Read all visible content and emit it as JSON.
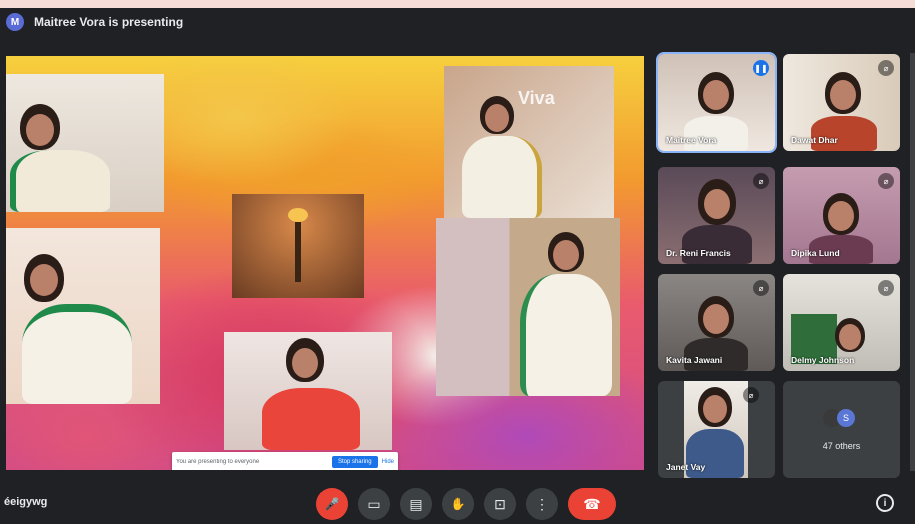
{
  "topbar": {
    "presenter_initial": "M",
    "presenting_text": "Maitree Vora is presenting"
  },
  "presentation": {
    "logo_text": "Viva",
    "banner": {
      "message": "You are presenting to everyone",
      "stop_label": "Stop sharing",
      "hide_label": "Hide"
    }
  },
  "participants": [
    {
      "name": "Maitree Vora",
      "speaking": true
    },
    {
      "name": "Dawat Dhar",
      "speaking": false
    },
    {
      "name": "Dr. Reni Francis",
      "speaking": false
    },
    {
      "name": "Dipika Lund",
      "speaking": false
    },
    {
      "name": "Kavita Jawani",
      "speaking": false
    },
    {
      "name": "Delmy Johnson",
      "speaking": false
    },
    {
      "name": "Janet Vay",
      "speaking": false
    }
  ],
  "others": {
    "avatar_letter": "S",
    "label": "47 others"
  },
  "bottombar": {
    "meeting_code": "éeigywg",
    "controls": {
      "mic": "🎤",
      "camera": "▭",
      "captions": "▤",
      "hand": "✋",
      "present": "⊡",
      "more": "⋮",
      "end": "☎"
    },
    "info": "i"
  },
  "colors": {
    "speaking": "#1a73e8",
    "end_call": "#ea4335",
    "active_outline": "#8ab4f8"
  }
}
